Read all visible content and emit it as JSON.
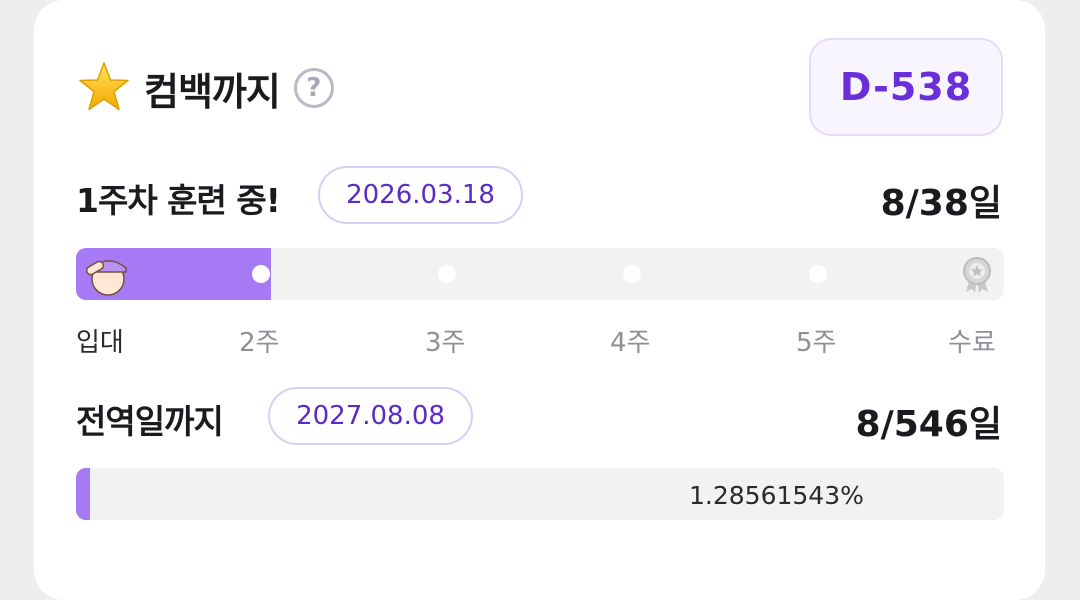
{
  "header": {
    "title": "컴백까지",
    "help": "?",
    "dday": "D-538"
  },
  "training": {
    "title": "1주차 훈련 중!",
    "date": "2026.03.18",
    "count": "8/38일",
    "progress": 0.21,
    "week_labels": [
      "입대",
      "2주",
      "3주",
      "4주",
      "5주",
      "수료"
    ]
  },
  "discharge": {
    "title": "전역일까지",
    "date": "2027.08.08",
    "count": "8/546일",
    "percent_text": "1.28561543%",
    "progress": 0.0128561543
  },
  "colors": {
    "accent": "#6a2fd8",
    "fill": "#a67af5"
  },
  "icons": {
    "star": "star-icon",
    "help": "help-icon",
    "avatar": "salute-avatar-icon",
    "medal": "medal-icon"
  }
}
